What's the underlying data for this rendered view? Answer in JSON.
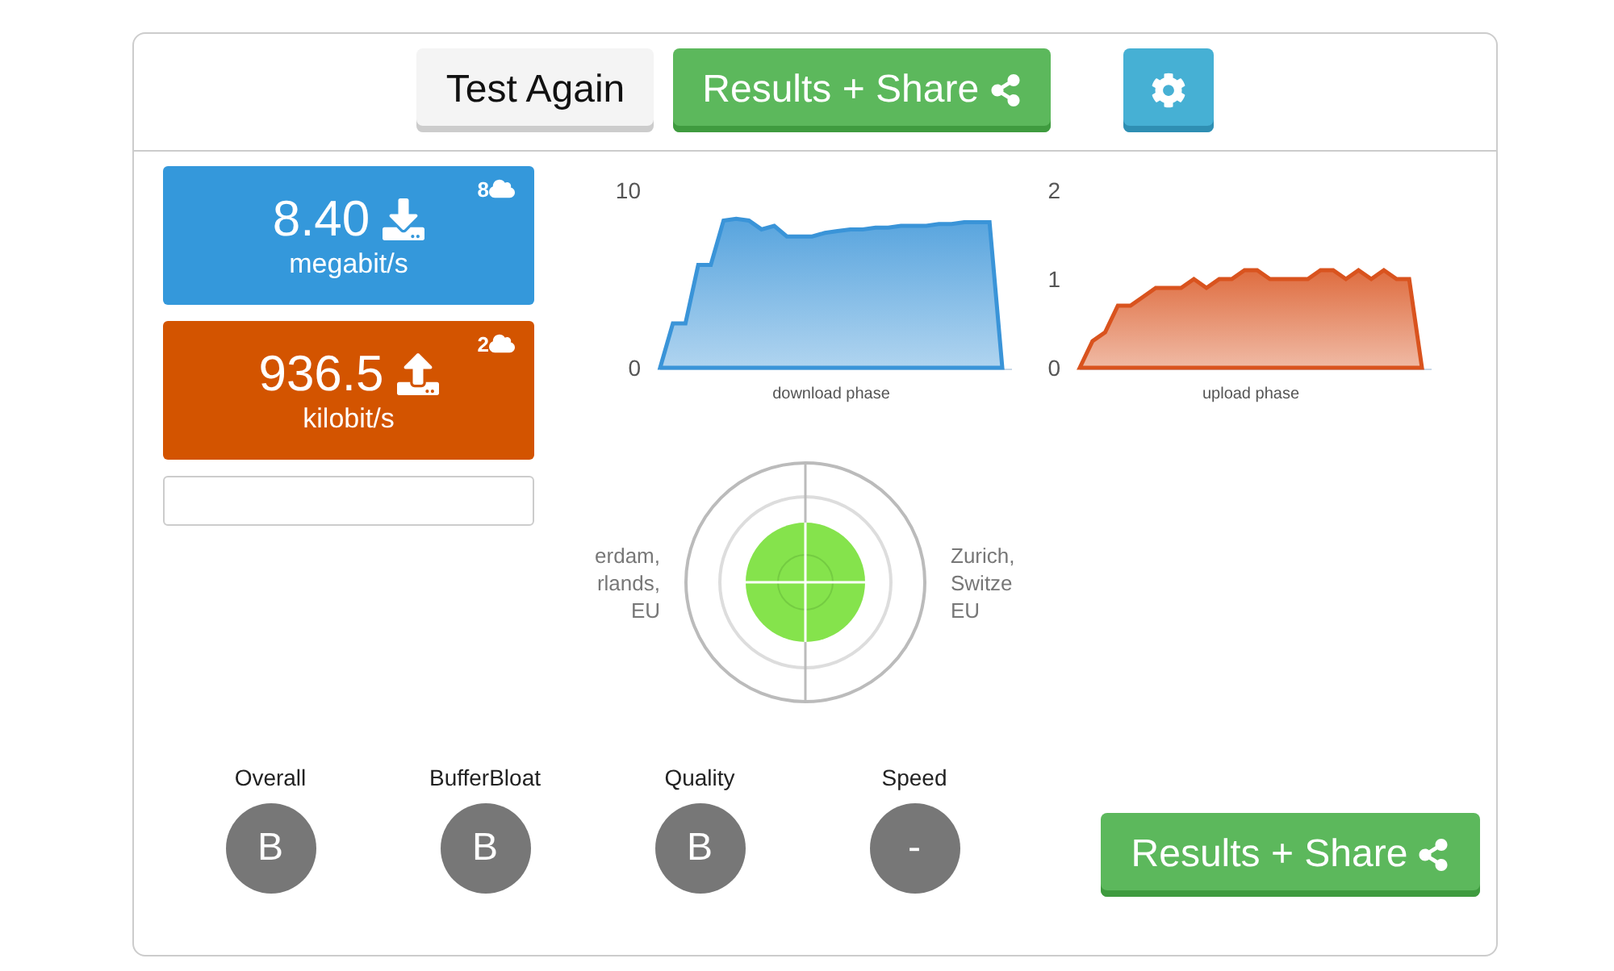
{
  "toolbar": {
    "buttons": [
      {
        "kind": "plain",
        "label": "Test Again"
      },
      {
        "kind": "share",
        "label": "Results + Share"
      },
      {
        "kind": "settings"
      }
    ]
  },
  "results": [
    {
      "kind": "download",
      "value": "8.40",
      "unit": "megabit/s",
      "count": "8",
      "color": "#3498db"
    },
    {
      "kind": "upload",
      "value": "936.5",
      "unit": "kilobit/s",
      "count": "2",
      "color": "#d35400"
    }
  ],
  "charts": [
    {
      "chart_data": {
        "type": "area",
        "xlabel": "download phase",
        "yticks": [
          0,
          10
        ],
        "ylim": [
          0,
          10
        ],
        "series": [
          {
            "color": "#3a94d8",
            "values": [
              0,
              2.5,
              2.5,
              5.8,
              5.8,
              8.3,
              8.4,
              8.3,
              7.8,
              8.0,
              7.4,
              7.4,
              7.4,
              7.6,
              7.7,
              7.8,
              7.8,
              7.9,
              7.9,
              8.0,
              8.0,
              8.0,
              8.1,
              8.1,
              8.2,
              8.2,
              8.2,
              0
            ]
          }
        ]
      }
    },
    {
      "chart_data": {
        "type": "area",
        "xlabel": "upload phase",
        "yticks": [
          0,
          1,
          2
        ],
        "ylim": [
          0,
          2
        ],
        "series": [
          {
            "color": "#d9531e",
            "values": [
              0,
              0.3,
              0.4,
              0.7,
              0.7,
              0.8,
              0.9,
              0.9,
              0.9,
              1.0,
              0.9,
              1.0,
              1.0,
              1.1,
              1.1,
              1.0,
              1.0,
              1.0,
              1.0,
              1.1,
              1.1,
              1.0,
              1.1,
              1.0,
              1.1,
              1.0,
              1.0,
              0
            ]
          }
        ]
      }
    }
  ],
  "servers": {
    "left": [
      "erdam,",
      "rlands,",
      "EU"
    ],
    "right": [
      "Zurich,",
      "Switze",
      "EU"
    ]
  },
  "grades": [
    {
      "label": "Overall",
      "grade": "B"
    },
    {
      "label": "BufferBloat",
      "grade": "B"
    },
    {
      "label": "Quality",
      "grade": "B"
    },
    {
      "label": "Speed",
      "grade": "-"
    }
  ],
  "share_button": {
    "label": "Results + Share"
  }
}
